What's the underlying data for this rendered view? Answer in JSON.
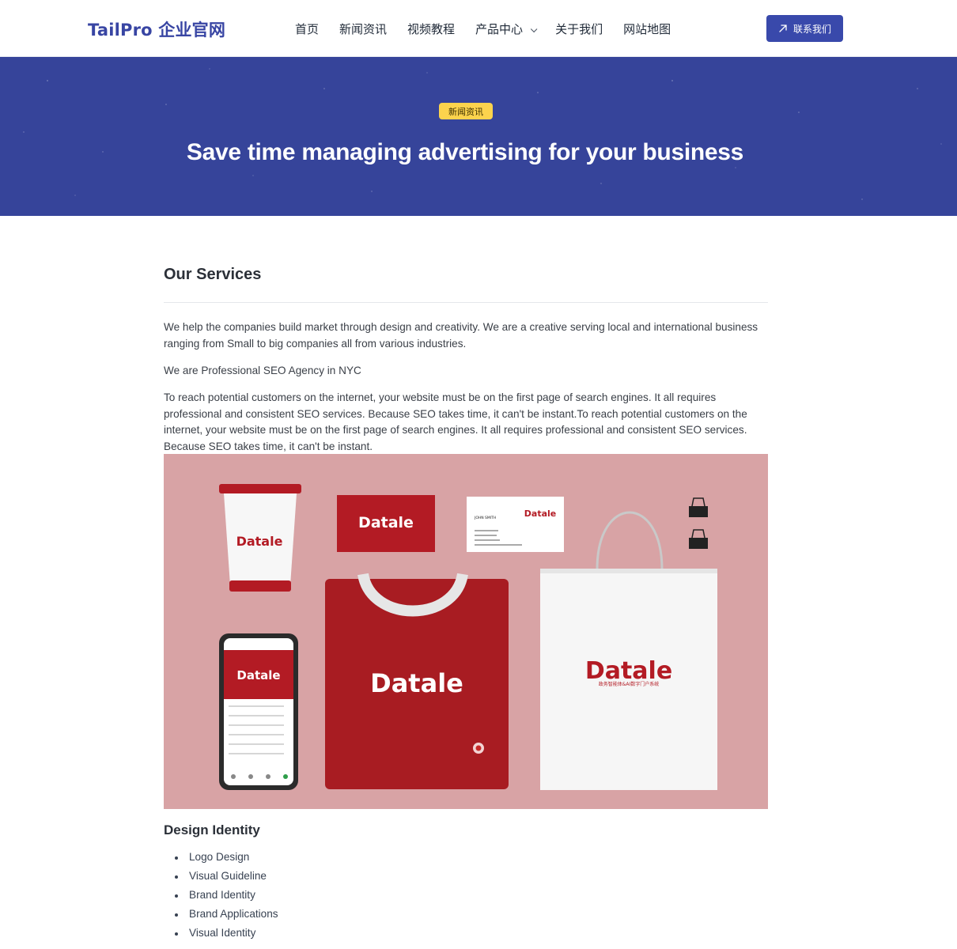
{
  "header": {
    "logo": "TailPro 企业官网",
    "nav": [
      {
        "label": "首页"
      },
      {
        "label": "新闻资讯"
      },
      {
        "label": "视频教程"
      },
      {
        "label": "产品中心"
      },
      {
        "label": "关于我们"
      },
      {
        "label": "网站地图"
      }
    ],
    "contact_label": "联系我们",
    "accent_color": "#3949ab"
  },
  "hero": {
    "badge": "新闻资讯",
    "title": "Save time managing advertising for your business",
    "bg_color": "#36449a",
    "badge_color": "#fcd34d"
  },
  "article": {
    "section_title": "Our Services",
    "paragraphs": [
      "We help the companies build market through design and creativity. We are a creative serving local and international business ranging from Small to big companies all from various industries.",
      "We are Professional SEO Agency in NYC",
      "To reach potential customers on the internet, your website must be on the first page of search engines. It all requires professional and consistent SEO services. Because SEO takes time, it can't be instant.To reach potential customers on the internet, your website must be on the first page of search engines. It all requires professional and consistent SEO services. Because SEO takes time, it can't be instant."
    ],
    "showcase": {
      "brand": "Datale",
      "brand_tagline": "政务智能体&AI数字门户系统",
      "card_name": "JOHN SMITH",
      "bg_color": "#d8a3a5",
      "brand_color": "#b31b24"
    },
    "subheading": "Design Identity",
    "list": [
      "Logo Design",
      "Visual Guideline",
      "Brand Identity",
      "Brand Applications",
      "Visual Identity"
    ]
  }
}
